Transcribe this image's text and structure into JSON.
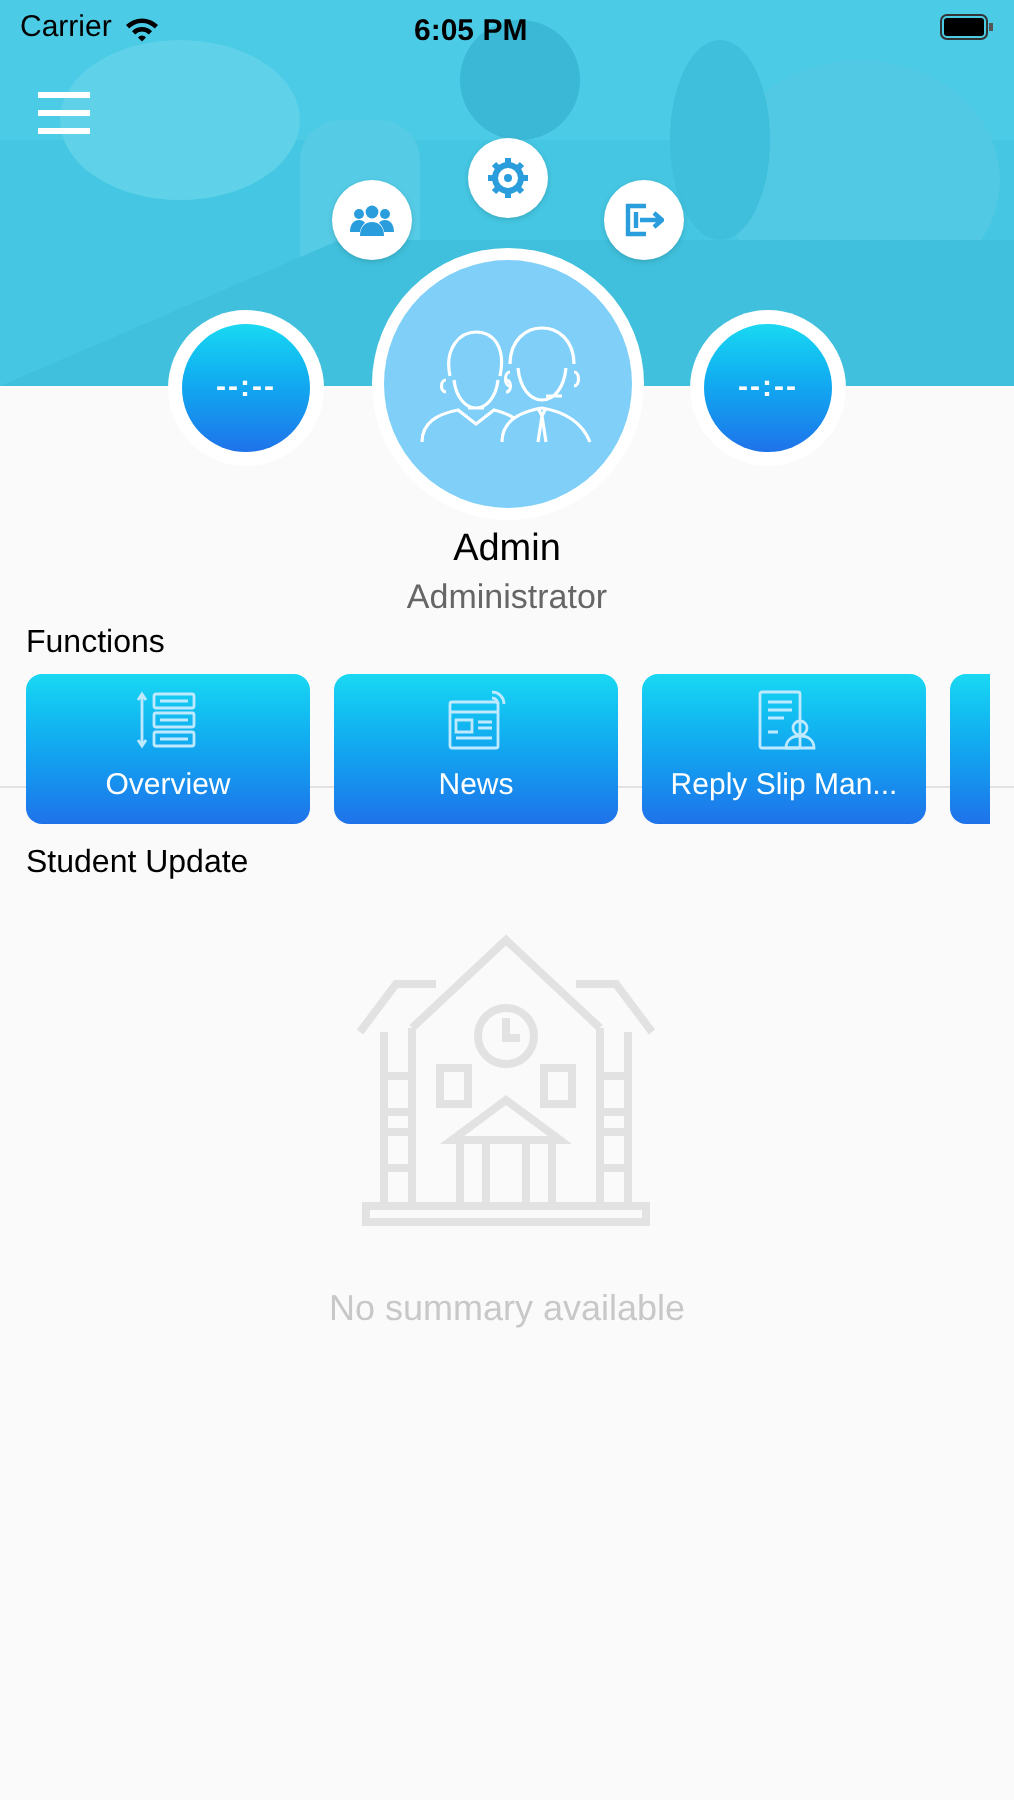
{
  "status_bar": {
    "carrier": "Carrier",
    "time": "6:05 PM"
  },
  "header": {
    "left_timer": "--:--",
    "right_timer": "--:--"
  },
  "profile": {
    "name": "Admin",
    "role": "Administrator"
  },
  "functions": {
    "title": "Functions",
    "items": [
      {
        "label": "Overview",
        "kind": "overview"
      },
      {
        "label": "News",
        "kind": "news"
      },
      {
        "label": "Reply Slip Man...",
        "kind": "reply-slip"
      }
    ]
  },
  "student_update": {
    "title": "Student Update",
    "empty_message": "No summary available"
  }
}
